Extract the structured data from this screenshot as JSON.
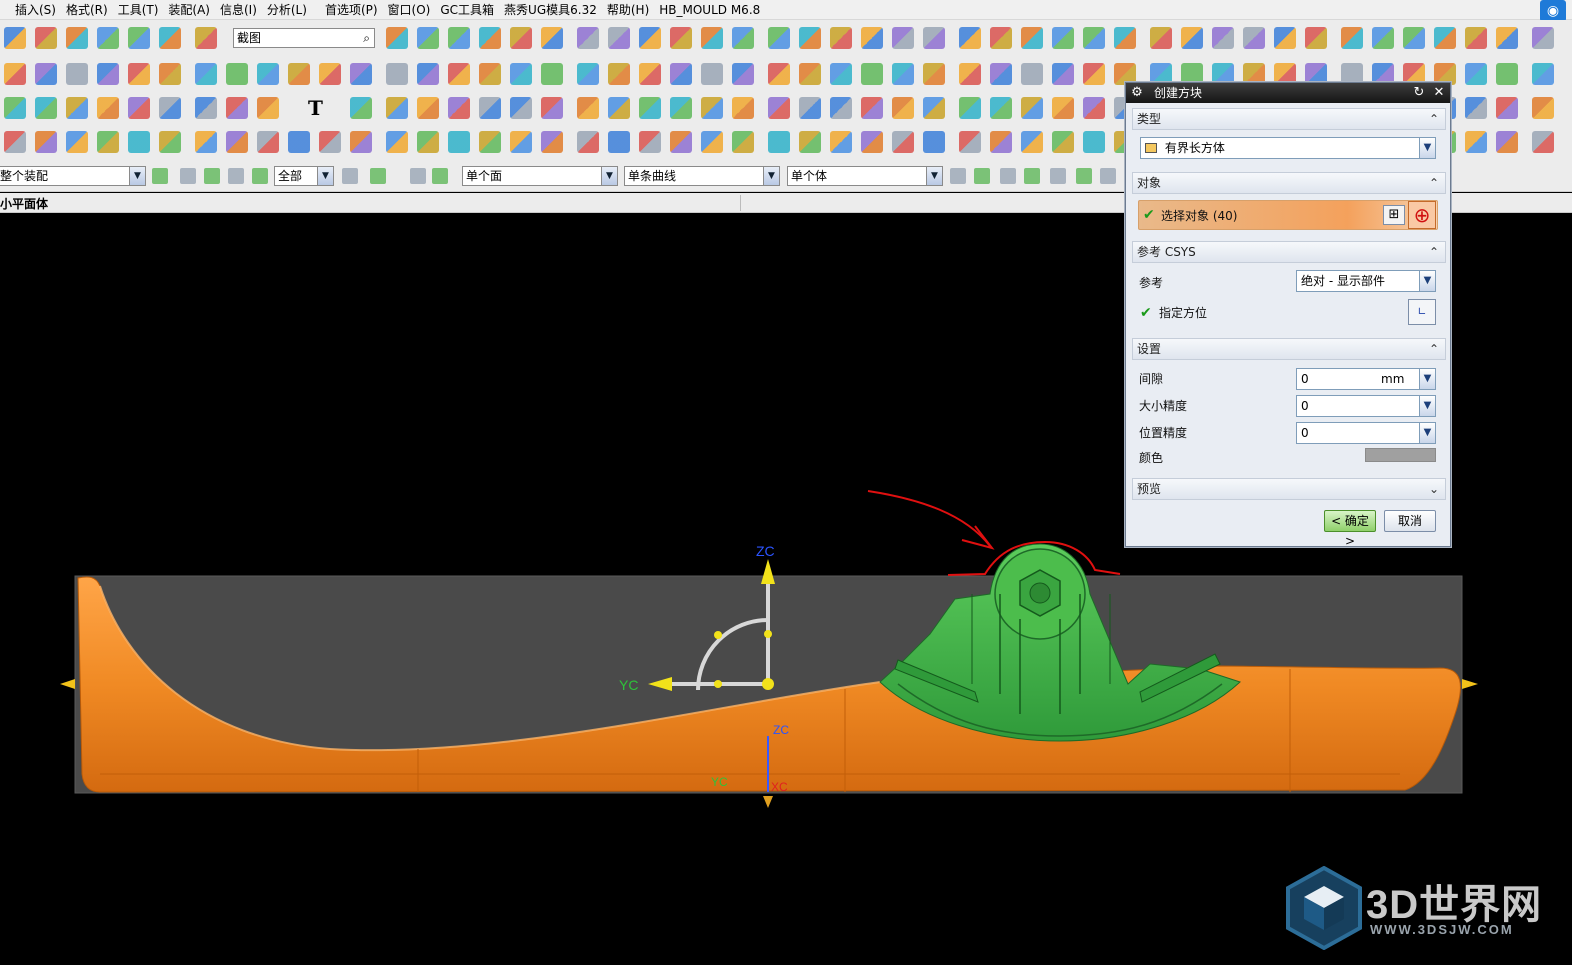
{
  "menu": {
    "items": [
      "插入(S)",
      "格式(R)",
      "工具(T)",
      "装配(A)",
      "信息(I)",
      "分析(L)",
      "首选项(P)",
      "窗口(O)",
      "GC工具箱",
      "燕秀UG模具6.32",
      "帮助(H)",
      "HB_MOULD M6.8"
    ]
  },
  "toolbar": {
    "search_value": "截图"
  },
  "filter_bar": {
    "assembly_scope": "整个装配",
    "type_filter": "全部",
    "face_rule": "单个面",
    "curve_rule": "单条曲线",
    "body_rule": "单个体"
  },
  "status": {
    "prompt": "小平面体"
  },
  "dialog": {
    "title": "创建方块",
    "sections": {
      "type": "类型",
      "object": "对象",
      "ref_csys": "参考 CSYS",
      "settings": "设置",
      "preview": "预览"
    },
    "type_value": "有界长方体",
    "select_object": "选择对象 (40)",
    "reference_label": "参考",
    "reference_value": "绝对 - 显示部件",
    "specify_orientation": "指定方位",
    "gap_label": "间隙",
    "gap_value": "0",
    "gap_unit": "mm",
    "size_precision_label": "大小精度",
    "size_precision_value": "0",
    "position_precision_label": "位置精度",
    "position_precision_value": "0",
    "color_label": "颜色",
    "color_value": "#a0a0a0",
    "ok_button": "< 确定 >",
    "cancel_button": "取消"
  },
  "viewport": {
    "axis_labels": {
      "zc_main": "ZC",
      "yc_main": "YC",
      "zc_small": "ZC",
      "yc_small": "YC",
      "xc_small": "XC"
    },
    "colors": {
      "background": "#000000",
      "block": "#4a4a4a",
      "part": "#f08a24",
      "insert": "#3fb34a",
      "annotation": "#e01010",
      "axis": "#f2e21a"
    }
  },
  "watermark": {
    "text": "3D世界网",
    "url": "WWW.3DSJW.COM"
  }
}
